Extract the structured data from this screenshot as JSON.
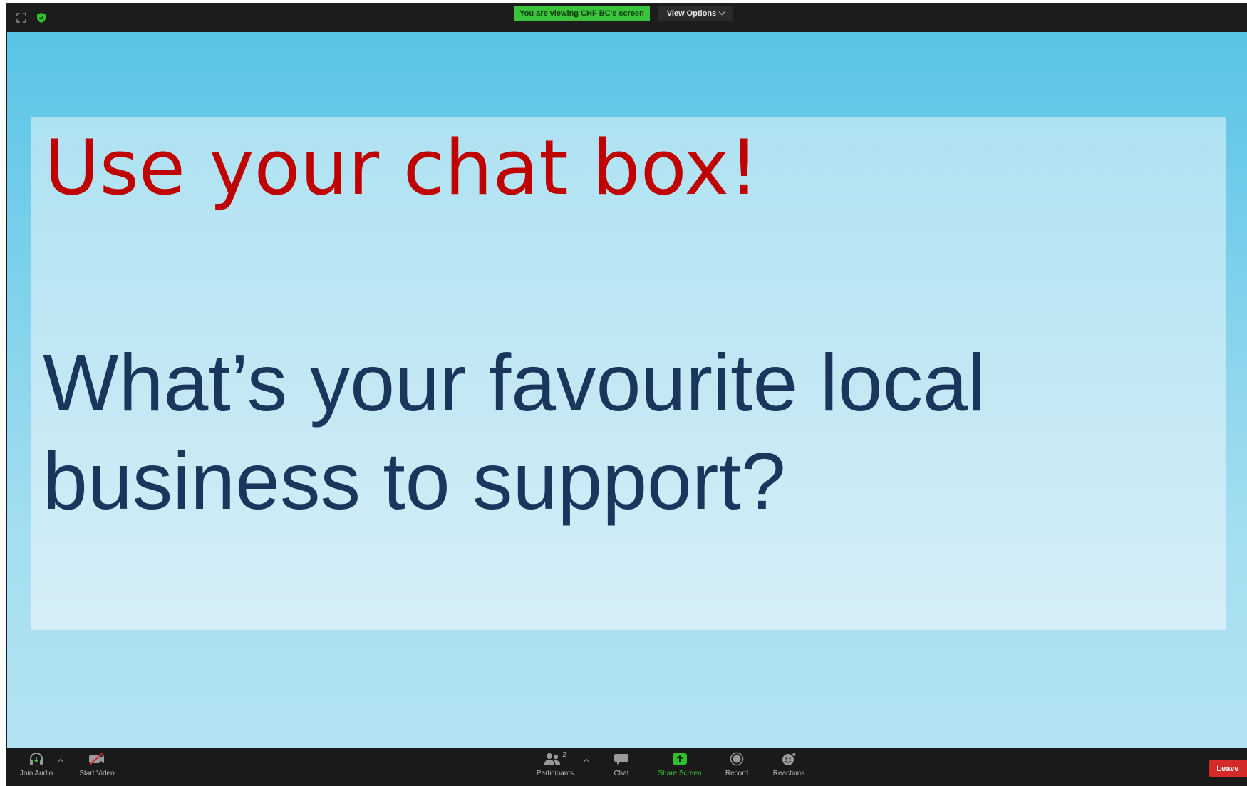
{
  "topbar": {
    "banner_text": "You are viewing CHF BC's screen",
    "view_options_label": "View Options",
    "icons": [
      "fullscreen-icon",
      "shield-icon"
    ]
  },
  "slide": {
    "heading": "Use your chat box!",
    "question_line1": "What’s your favourite local",
    "question_line2": "business to support?"
  },
  "toolbar": {
    "join_audio": "Join Audio",
    "start_video": "Start Video",
    "participants": "Participants",
    "participants_count": "2",
    "chat": "Chat",
    "share_screen": "Share Screen",
    "record": "Record",
    "reactions": "Reactions",
    "leave": "Leave"
  },
  "colors": {
    "banner_green": "#3bc43b",
    "heading_red": "#c00000",
    "question_navy": "#1a365d",
    "leave_red": "#d42a2a",
    "background_blue": "#58c4e5"
  }
}
